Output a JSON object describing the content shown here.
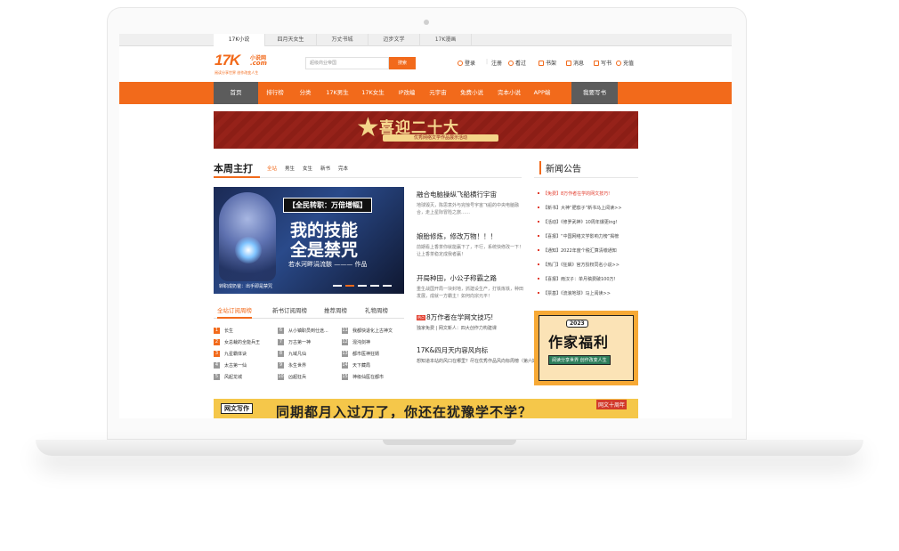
{
  "channels": [
    {
      "label": "17K小说",
      "active": true
    },
    {
      "label": "四月天女生",
      "active": false
    },
    {
      "label": "万丈书城",
      "active": false
    },
    {
      "label": "迈步文学",
      "active": false
    },
    {
      "label": "17K漫画",
      "active": false
    }
  ],
  "logo": {
    "main": "17K",
    "sub": "小说网",
    "com": ".com",
    "slogan": "阅读分享世界  创作改变人生"
  },
  "search": {
    "placeholder": "超级商业帝国",
    "button": "搜索"
  },
  "user_links": {
    "login": "登录",
    "register": "注册",
    "recent": "看过",
    "shelf": "书架",
    "message": "消息",
    "write": "写书",
    "recharge": "充值",
    "sep": "|"
  },
  "nav": [
    "首页",
    "排行榜",
    "分类",
    "17K男生",
    "17K女生",
    "IP改编",
    "元宇宙",
    "免费小说",
    "完本小说",
    "APP端",
    "我要写书"
  ],
  "banner": {
    "title": "喜迎二十大",
    "subtitle": "优秀网络文学作品展示活动"
  },
  "weekly": {
    "title": "本周主打",
    "filters": [
      {
        "label": "全站",
        "active": true
      },
      {
        "label": "男生",
        "active": false
      },
      {
        "label": "女生",
        "active": false
      },
      {
        "label": "新书",
        "active": false
      },
      {
        "label": "完本",
        "active": false
      }
    ]
  },
  "hero": {
    "tag": "【全民转职：万倍增幅】",
    "title1": "我的技能",
    "title2": "全是禁咒",
    "author": "若水河畔涓流骸 ——— 作品",
    "caption": "转职成奶爸：出手即是禁咒"
  },
  "features": [
    {
      "title": "融合电脑操纵飞船横行宇宙",
      "desc": "地球毁灭，陈思意外与完惊号宇宙飞船的中央电脑融合，走上星际冒险之旅……"
    },
    {
      "title": "娘胎修炼，修改万物！！！",
      "desc": "前期看上香茶你就能赢下了，不行，系统快修改一下！让上香茶稳定成我者赢！"
    },
    {
      "title": "开局种田，小公子称霸之路",
      "desc": "重生战国开局一块封地，抓建设生产，打铁炼铁，种田发展，成就一方霸主！如何向宗元平！"
    }
  ],
  "mini_news": {
    "badge": "热点",
    "title": "8万作者在学网文技巧!",
    "desc": "独家免费 | 网文新人：四大创作力构建课"
  },
  "mini_news2": {
    "title": "17K&四月天内容风向标",
    "desc": "想知道本站的风口在哪里？尽在优秀作品风向标周榜（第六期）"
  },
  "rank": {
    "tabs": [
      {
        "label": "全站订阅周榜",
        "active": true
      },
      {
        "label": "新书订阅周榜",
        "active": false
      },
      {
        "label": "推荐周榜",
        "active": false
      },
      {
        "label": "礼物周榜",
        "active": false
      }
    ],
    "col1": [
      {
        "n": "1",
        "name": "长生"
      },
      {
        "n": "2",
        "name": "女总裁的全能兵王"
      },
      {
        "n": "3",
        "name": "九星霸体诀"
      },
      {
        "n": "4",
        "name": "太古第一仙"
      },
      {
        "n": "5",
        "name": "风起龙城"
      }
    ],
    "col2": [
      {
        "n": "6",
        "name": "从小镇职员到仕途..."
      },
      {
        "n": "7",
        "name": "万古第一神"
      },
      {
        "n": "8",
        "name": "九域凡仙"
      },
      {
        "n": "9",
        "name": "永生世界"
      },
      {
        "n": "10",
        "name": "凶超狂兵"
      }
    ],
    "col3": [
      {
        "n": "11",
        "name": "我都快退化上古神文"
      },
      {
        "n": "12",
        "name": "混沌剑神"
      },
      {
        "n": "13",
        "name": "都市医神狂婿"
      },
      {
        "n": "14",
        "name": "天下藏局"
      },
      {
        "n": "15",
        "name": "神级仙医在都市"
      }
    ]
  },
  "news": {
    "title": "新闻公告",
    "items": [
      {
        "text": "【免费】8万作者在学的网文技巧!",
        "hot": true
      },
      {
        "text": "【新书】大神“肥茄子”新书马上阅读>>",
        "hot": false
      },
      {
        "text": "【活动】《修罗武神》10周年爆更ing!",
        "hot": false
      },
      {
        "text": "【喜报】“中国网络文学影响力榜”揭榜",
        "hot": false
      },
      {
        "text": "【通知】2022年度个税汇算清缴通知",
        "hot": false
      },
      {
        "text": "【热门】《狂飙》官方授权同名小说>>",
        "hot": false
      },
      {
        "text": "【喜报】雨汉子：单月稿费破100万!",
        "hot": false
      },
      {
        "text": "【票基】《流浪地球》马上阅读>>",
        "hot": false
      }
    ]
  },
  "promo": {
    "year": "2023",
    "title": "作家福利",
    "sub": "阅读分享世界 创作改变人生"
  },
  "strip": {
    "tag": "网文写作",
    "text": "同期都月入过万了，你还在犹豫学不学？",
    "badge": "网文十周年"
  }
}
